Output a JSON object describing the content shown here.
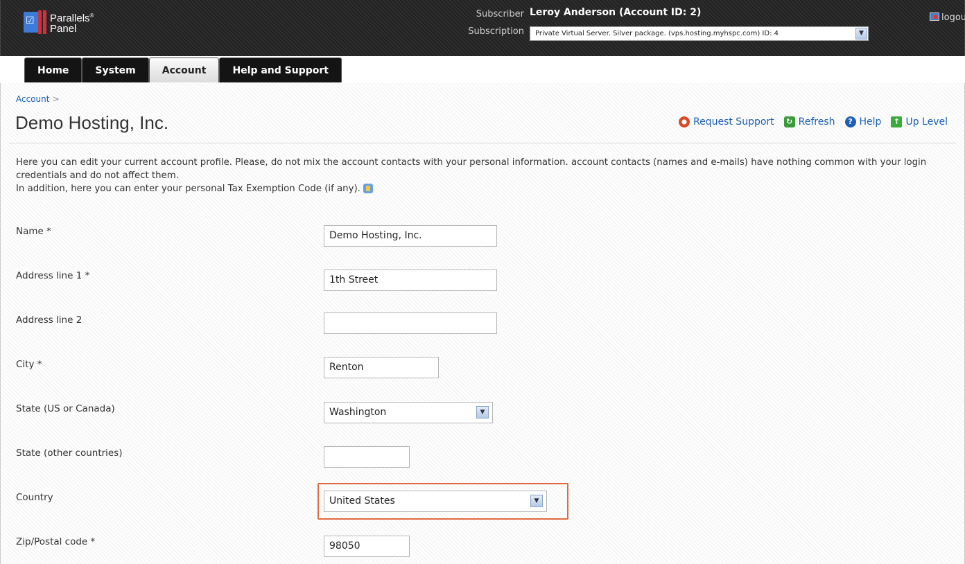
{
  "header": {
    "logo_text_1": "Parallels",
    "logo_text_2": "Panel",
    "subscriber_label": "Subscriber",
    "subscription_label": "Subscription",
    "subscriber_name": "Leroy Anderson (Account ID: 2)",
    "subscription_value": "Private Virtual Server. Silver package. (vps.hosting.myhspc.com) ID: 4",
    "logout": "logout"
  },
  "tabs": [
    {
      "label": "Home"
    },
    {
      "label": "System"
    },
    {
      "label": "Account"
    },
    {
      "label": "Help and Support"
    }
  ],
  "breadcrumb": {
    "item": "Account",
    "sep": ">"
  },
  "page_title": "Demo Hosting, Inc.",
  "actions": {
    "request_support": "Request Support",
    "refresh": "Refresh",
    "help": "Help",
    "up_level": "Up Level"
  },
  "intro": {
    "line1": "Here you can edit your current account profile. Please, do not mix the account contacts with your personal information. account contacts (names and e-mails) have nothing common with your login credentials and do not affect them.",
    "line2": "In addition, here you can enter your personal Tax Exemption Code (if any)."
  },
  "form": {
    "name": {
      "label": "Name *",
      "value": "Demo Hosting, Inc."
    },
    "address1": {
      "label": "Address line 1 *",
      "value": "1th Street"
    },
    "address2": {
      "label": "Address line 2",
      "value": ""
    },
    "city": {
      "label": "City *",
      "value": "Renton"
    },
    "state_us": {
      "label": "State (US or Canada)",
      "value": "Washington"
    },
    "state_other": {
      "label": "State (other countries)",
      "value": ""
    },
    "country": {
      "label": "Country",
      "value": "United States"
    },
    "zip": {
      "label": "Zip/Postal code *",
      "value": "98050"
    }
  },
  "colors": {
    "accent": "#1a5fb4",
    "highlight": "#e06a3f"
  }
}
